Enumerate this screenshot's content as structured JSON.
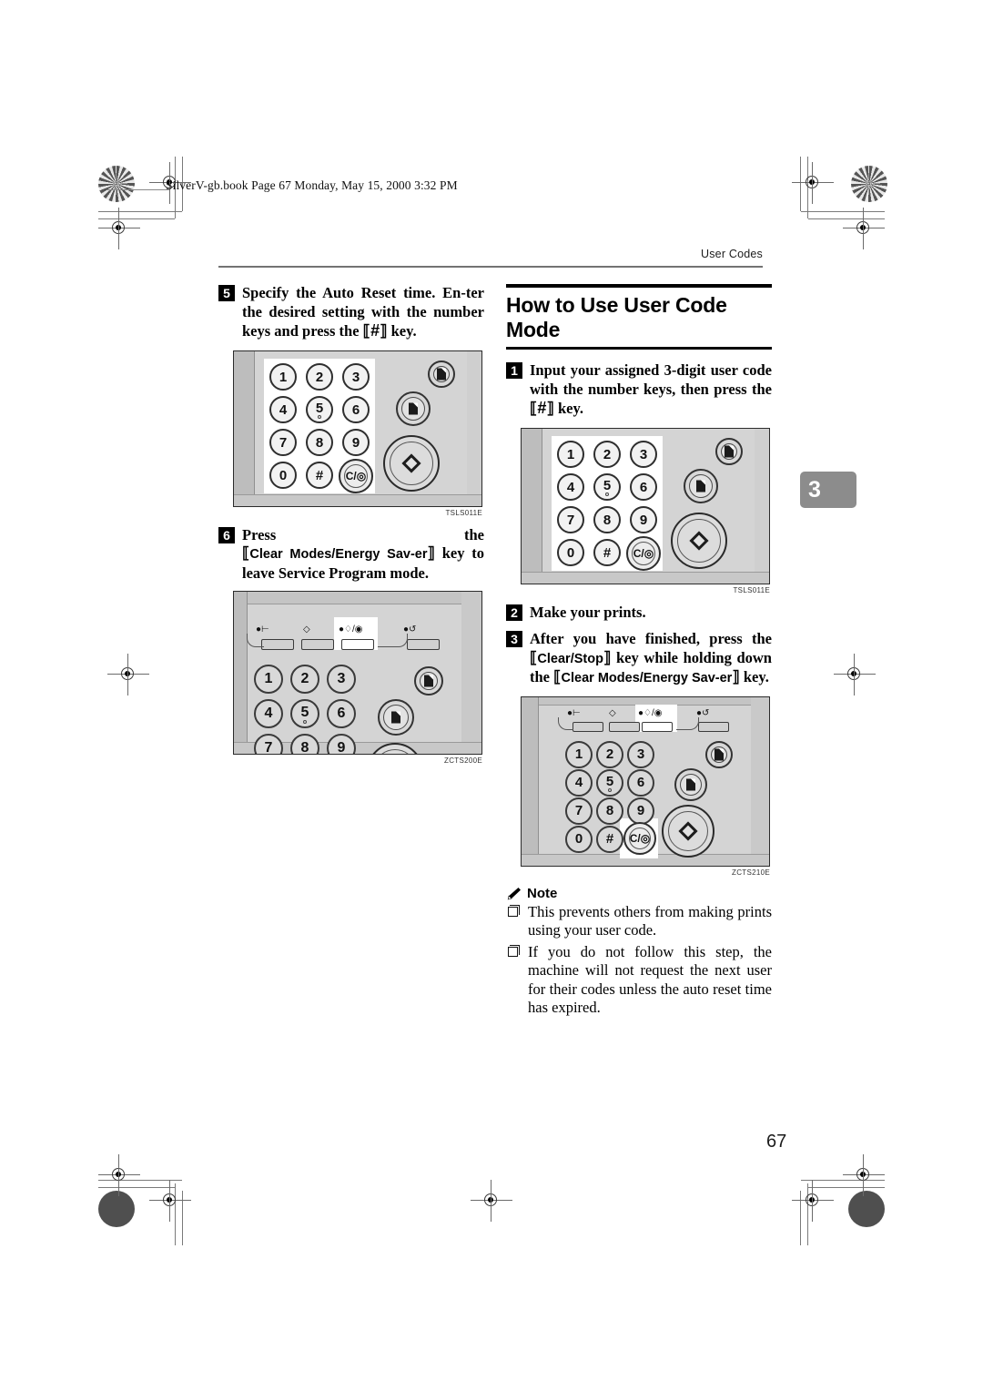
{
  "document": {
    "book_line": "SilverV-gb.book  Page 67  Monday, May 15, 2000  3:32 PM",
    "running_head": "User Codes",
    "chapter_tab": "3",
    "page_number": "67"
  },
  "left_column": {
    "step5": {
      "number": "5",
      "text_part1": "Specify the Auto Reset time. En-ter the desired setting with the number keys and press the ",
      "key_hash": "#",
      "text_part2": " key."
    },
    "figure1": {
      "caption": "TSLS011E"
    },
    "step6": {
      "number": "6",
      "text_part1": "Press the ",
      "key_label": "Clear Modes/Energy Sav-er",
      "text_part2": " key to leave Service Program mode."
    },
    "figure2": {
      "caption": "ZCTS200E"
    }
  },
  "right_column": {
    "section_title": "How to Use User Code Mode",
    "step1": {
      "number": "1",
      "text_part1": "Input your assigned 3-digit user code with the number keys, then press the ",
      "key_hash": "#",
      "text_part2": " key."
    },
    "figure3": {
      "caption": "TSLS011E"
    },
    "step2": {
      "number": "2",
      "text": "Make your prints."
    },
    "step3": {
      "number": "3",
      "text_part1": "After you have finished, press the ",
      "key_label1": "Clear/Stop",
      "text_part2": " key while holding down the ",
      "key_label2": "Clear Modes/Energy Sav-er",
      "text_part3": " key."
    },
    "figure4": {
      "caption": "ZCTS210E"
    },
    "note": {
      "title": "Note",
      "items": [
        "This prevents others from making prints using your user code.",
        "If you do not follow this step, the machine will not request the next user for their codes unless the auto reset time has expired."
      ]
    }
  },
  "keypad": {
    "keys": [
      "1",
      "2",
      "3",
      "4",
      "5",
      "6",
      "7",
      "8",
      "9",
      "0",
      "#"
    ],
    "clear_key_label": "C/",
    "start_key": "start-diamond",
    "function_keys": [
      "interrupt",
      "program",
      "clear-modes-energy-saver",
      "repeat"
    ]
  },
  "colors": {
    "panel_gray": "#d4d4d4",
    "tab_gray": "#8c8c8c",
    "rule_gray": "#737373",
    "ink": "#000000"
  }
}
